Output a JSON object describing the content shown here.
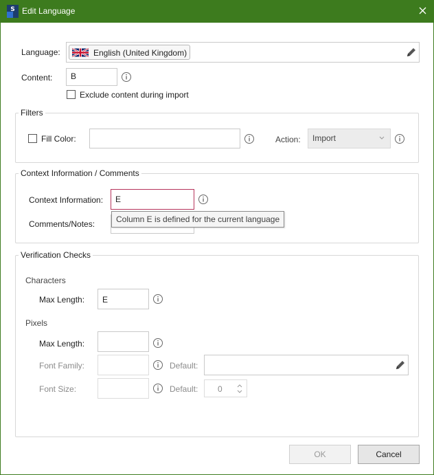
{
  "window": {
    "title": "Edit Language",
    "accent": "#3d7b1e"
  },
  "language": {
    "label": "Language:",
    "value": "English (United Kingdom)",
    "flag": "uk-flag-icon"
  },
  "content": {
    "label": "Content:",
    "value": "B"
  },
  "exclude": {
    "label": "Exclude content during import",
    "checked": false
  },
  "filters": {
    "title": "Filters",
    "fill_color_label": "Fill Color:",
    "fill_color_checked": false,
    "fill_color_value": "",
    "action_label": "Action:",
    "action_value": "Import"
  },
  "context": {
    "title": "Context Information / Comments",
    "context_label": "Context Information:",
    "context_value": "E",
    "comments_label": "Comments/Notes:",
    "comments_value": "",
    "tooltip": "Column E is defined for the current language"
  },
  "verification": {
    "title": "Verification Checks",
    "characters_heading": "Characters",
    "char_max_label": "Max Length:",
    "char_max_value": "E",
    "pixels_heading": "Pixels",
    "px_max_label": "Max Length:",
    "px_max_value": "",
    "font_family_label": "Font Family:",
    "font_family_value": "",
    "font_family_default_label": "Default:",
    "font_family_default_value": "",
    "font_size_label": "Font Size:",
    "font_size_value": "",
    "font_size_default_label": "Default:",
    "font_size_default_value": "0"
  },
  "buttons": {
    "ok": "OK",
    "cancel": "Cancel"
  }
}
